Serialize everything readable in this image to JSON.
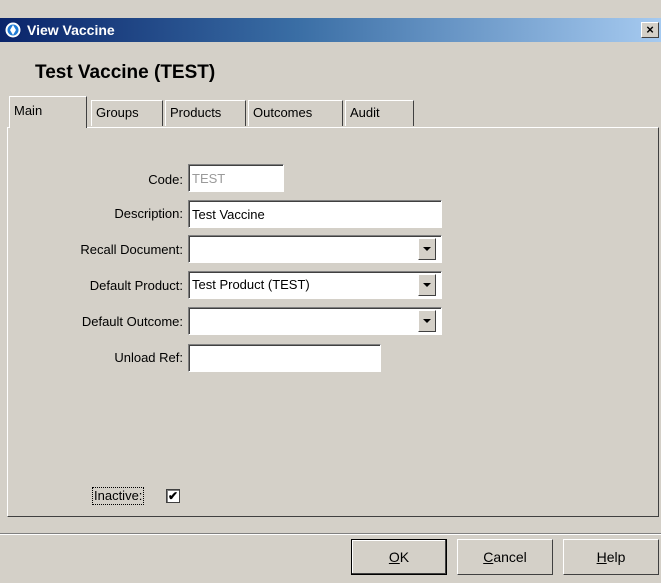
{
  "window": {
    "title": "View Vaccine",
    "close_label": "×",
    "bg_color": "#d4d0c8",
    "title_color": "#0a246a"
  },
  "header": {
    "title": "Test Vaccine (TEST)"
  },
  "tabs": [
    {
      "label": "Main",
      "active": true
    },
    {
      "label": "Groups"
    },
    {
      "label": "Products"
    },
    {
      "label": "Outcomes"
    },
    {
      "label": "Audit"
    }
  ],
  "form": {
    "code": {
      "label": "Code:",
      "value": "TEST"
    },
    "description": {
      "label": "Description:",
      "value": "Test Vaccine"
    },
    "recall_document": {
      "label": "Recall Document:",
      "value": ""
    },
    "default_product": {
      "label": "Default Product:",
      "value": "Test Product (TEST)"
    },
    "default_outcome": {
      "label": "Default Outcome:",
      "value": ""
    },
    "unload_ref": {
      "label": "Unload Ref:",
      "value": ""
    },
    "inactive": {
      "label": "Inactive:",
      "checked": true,
      "mark": "✔"
    }
  },
  "buttons": {
    "ok": {
      "mnemonic": "O",
      "rest": "K"
    },
    "cancel": {
      "mnemonic": "C",
      "rest": "ancel"
    },
    "help": {
      "mnemonic": "H",
      "rest": "elp"
    }
  }
}
